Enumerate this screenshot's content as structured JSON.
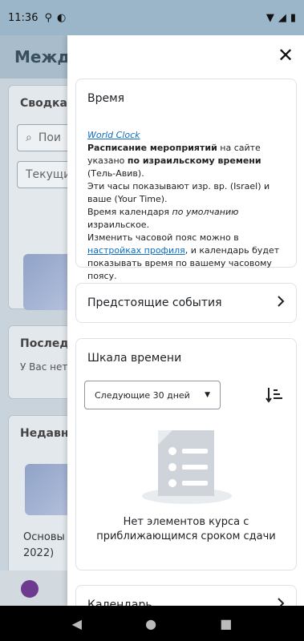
{
  "status_bar": {
    "time": "11:36"
  },
  "background": {
    "header_title": "Междун",
    "summary_title": "Сводка п",
    "search_placeholder": "Пои",
    "filter_label": "Текущие",
    "last_title": "Последн",
    "last_text": "У Вас нет",
    "recent_title": "Недавно",
    "course_name": "Основы",
    "course_year": "2022)"
  },
  "drawer": {
    "time_block": {
      "title": "Время",
      "world_clock_link": "World Clock",
      "schedule_bold": "Расписание мероприятий",
      "schedule_rest": " на сайте указано ",
      "israel_time_bold": "по израильскому времени",
      "tel_aviv": " (Тель-Авив).",
      "clocks_text": "Эти часы показывают изр. вр. (Israel) и ваше (Your Time).",
      "calendar_time_prefix": "Время календаря ",
      "by_default": "по умолчанию",
      "calendar_time_suffix": " израильское.",
      "change_tz_prefix": "Изменить часовой пояс можно в ",
      "profile_settings_link": "настройках профиля",
      "change_tz_suffix": ", и календарь будет показывать время по вашему часовому поясу."
    },
    "upcoming_events": {
      "title": "Предстоящие события"
    },
    "timeline": {
      "title": "Шкала времени",
      "filter_selected": "Следующие 30 дней",
      "empty_message": "Нет элементов курса с приближающимся сроком сдачи"
    },
    "calendar": {
      "title": "Календарь"
    }
  }
}
